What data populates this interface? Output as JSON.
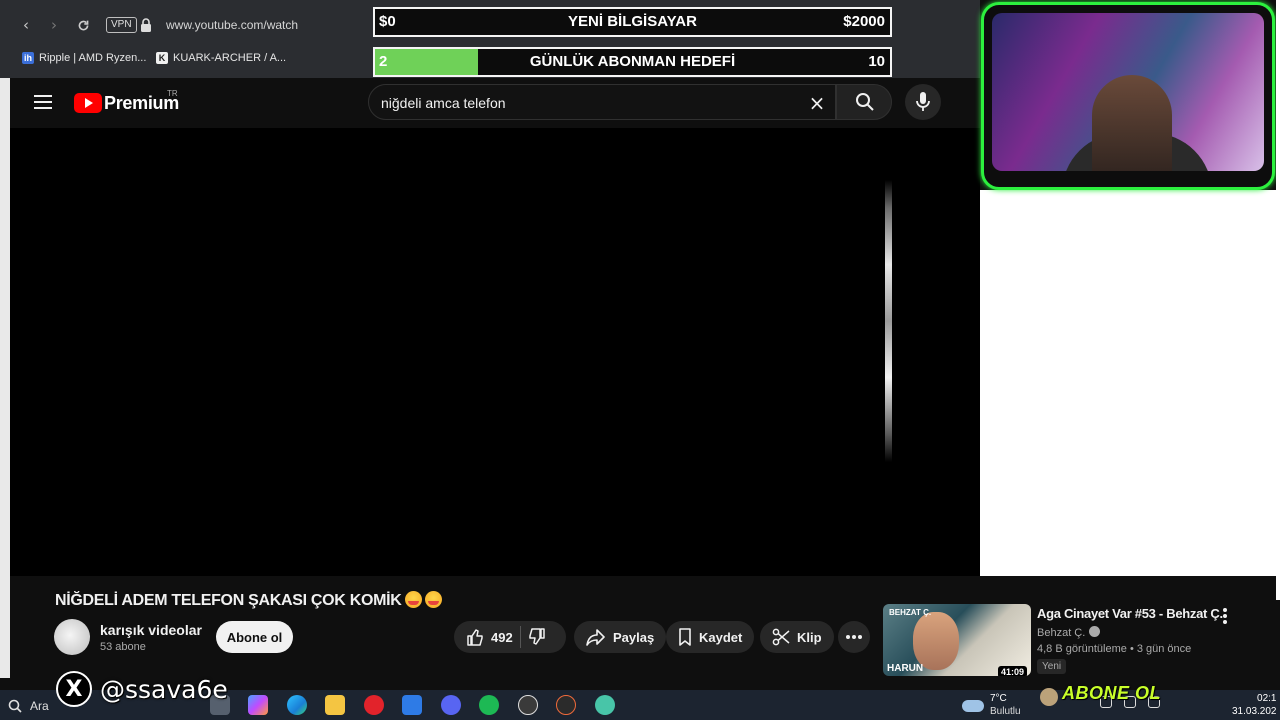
{
  "browser": {
    "url": "www.youtube.com/watch",
    "vpn_label": "VPN",
    "bookmarks": [
      {
        "label": "Ripple | AMD Ryzen...",
        "icon": "ih"
      },
      {
        "label": "KUARK-ARCHER / A...",
        "icon": "K"
      }
    ]
  },
  "overlay": {
    "computer_goal": {
      "start": "$0",
      "title": "YENİ BİLGİSAYAR",
      "end": "$2000"
    },
    "sub_goal": {
      "current": "2",
      "title": "GÜNLÜK ABONMAN HEDEFİ",
      "target": "10",
      "progress": 0.2
    },
    "social_handle": "@ssava6e",
    "abone_ol": "ABONE OL"
  },
  "header": {
    "brand": "Premium",
    "region": "TR",
    "search_query": "niğdeli amca telefon"
  },
  "video": {
    "title": "NİĞDELİ ADEM TELEFON ŞAKASI ÇOK KOMİK",
    "channel_name": "karışık videolar",
    "subscribers": "53 abone",
    "subscribe_label": "Abone ol",
    "likes": "492",
    "share_label": "Paylaş",
    "save_label": "Kaydet",
    "clip_label": "Klip"
  },
  "recommended": {
    "title": "Aga Cinayet Var #53 - Behzat Ç.",
    "channel": "Behzat Ç.",
    "meta": "4,8 B görüntüleme • 3 gün önce",
    "badge": "Yeni",
    "duration": "41:09",
    "thumb_top_text": "BEHZAT Ç.",
    "thumb_name": "HARUN"
  },
  "taskbar": {
    "search_label": "Ara",
    "weather_temp": "7°C",
    "weather_desc": "Bulutlu",
    "time": "02:1",
    "date": "31.03.202"
  },
  "colors": {
    "youtube_red": "#ff0000",
    "goal_fill": "#6fd158",
    "webcam_frame": "#2cf03e",
    "abone_text": "#c8ff2a"
  }
}
